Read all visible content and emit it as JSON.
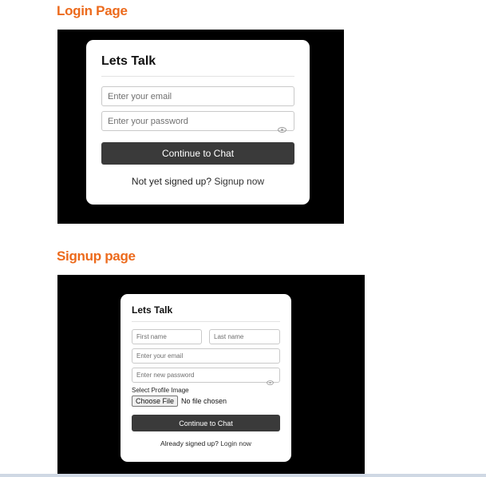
{
  "login_section": {
    "heading": "Login Page",
    "card_title": "Lets Talk",
    "email_placeholder": "Enter your email",
    "password_placeholder": "Enter your password",
    "submit_label": "Continue to Chat",
    "footer_text": "Not yet signed up?",
    "footer_link": "Signup now"
  },
  "signup_section": {
    "heading": "Signup page",
    "card_title": "Lets Talk",
    "first_name_placeholder": "First name",
    "last_name_placeholder": "Last name",
    "email_placeholder": "Enter your email",
    "password_placeholder": "Enter new password",
    "profile_image_label": "Select Profile Image",
    "choose_file_label": "Choose File",
    "no_file_text": "No file chosen",
    "submit_label": "Continue to Chat",
    "footer_text": "Already signed up?",
    "footer_link": "Login now"
  },
  "icons": {
    "password_toggle": "eye-icon"
  },
  "colors": {
    "heading": "#ec6a1c",
    "frame": "#000000",
    "button": "#3a3a3a"
  }
}
